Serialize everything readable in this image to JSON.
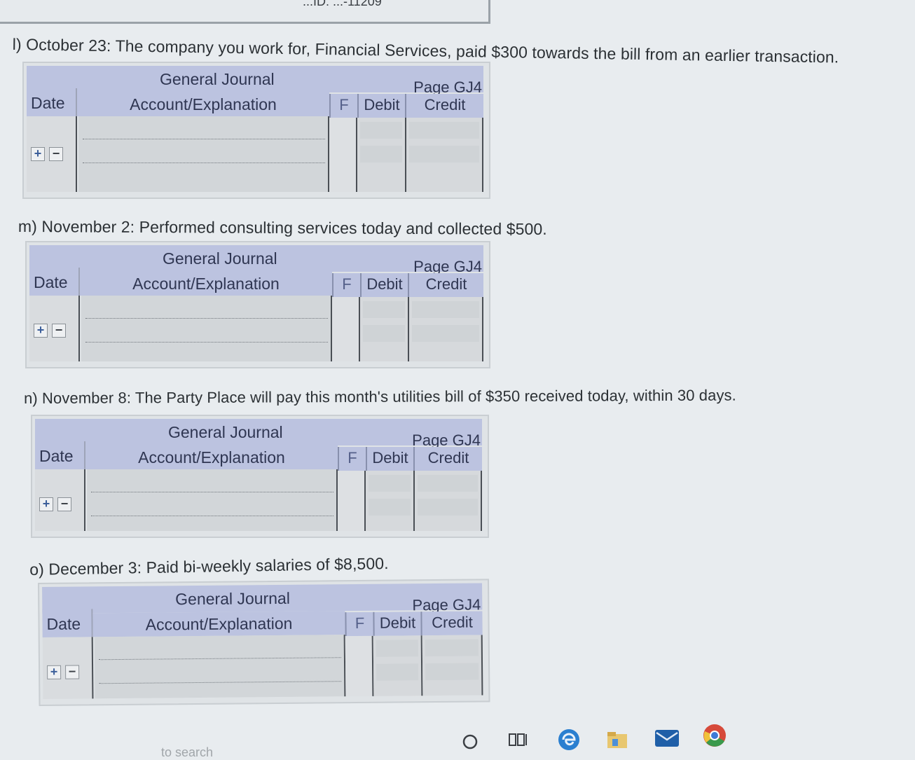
{
  "top_fragment": "...ID: ...-11209",
  "questions": [
    {
      "id": "l",
      "prompt": "l) October 23: The company you work for, Financial Services, paid $300 towards the bill from an earlier transaction.",
      "journal": {
        "title": "General Journal",
        "page": "Page GJ4",
        "columns": [
          "Date",
          "Account/Explanation",
          "F",
          "Debit",
          "Credit"
        ]
      }
    },
    {
      "id": "m",
      "prompt": "m) November 2: Performed consulting services today and collected $500.",
      "journal": {
        "title": "General Journal",
        "page": "Page GJ4",
        "columns": [
          "Date",
          "Account/Explanation",
          "F",
          "Debit",
          "Credit"
        ]
      }
    },
    {
      "id": "n",
      "prompt": "n) November 8: The Party Place will pay this month's utilities bill of $350 received today, within 30 days.",
      "journal": {
        "title": "General Journal",
        "page": "Page GJ4",
        "columns": [
          "Date",
          "Account/Explanation",
          "F",
          "Debit",
          "Credit"
        ]
      }
    },
    {
      "id": "o",
      "prompt": "o) December 3: Paid bi-weekly salaries of $8,500.",
      "journal": {
        "title": "General Journal",
        "page": "Page GJ4",
        "columns": [
          "Date",
          "Account/Explanation",
          "F",
          "Debit",
          "Credit"
        ]
      }
    }
  ],
  "row_buttons": {
    "add": "+",
    "remove": "−"
  },
  "taskbar": {
    "search_fragment": "to search",
    "icons": [
      "cortana-circle-icon",
      "task-view-icon",
      "edge-icon",
      "file-explorer-icon",
      "mail-icon",
      "chrome-icon"
    ]
  }
}
